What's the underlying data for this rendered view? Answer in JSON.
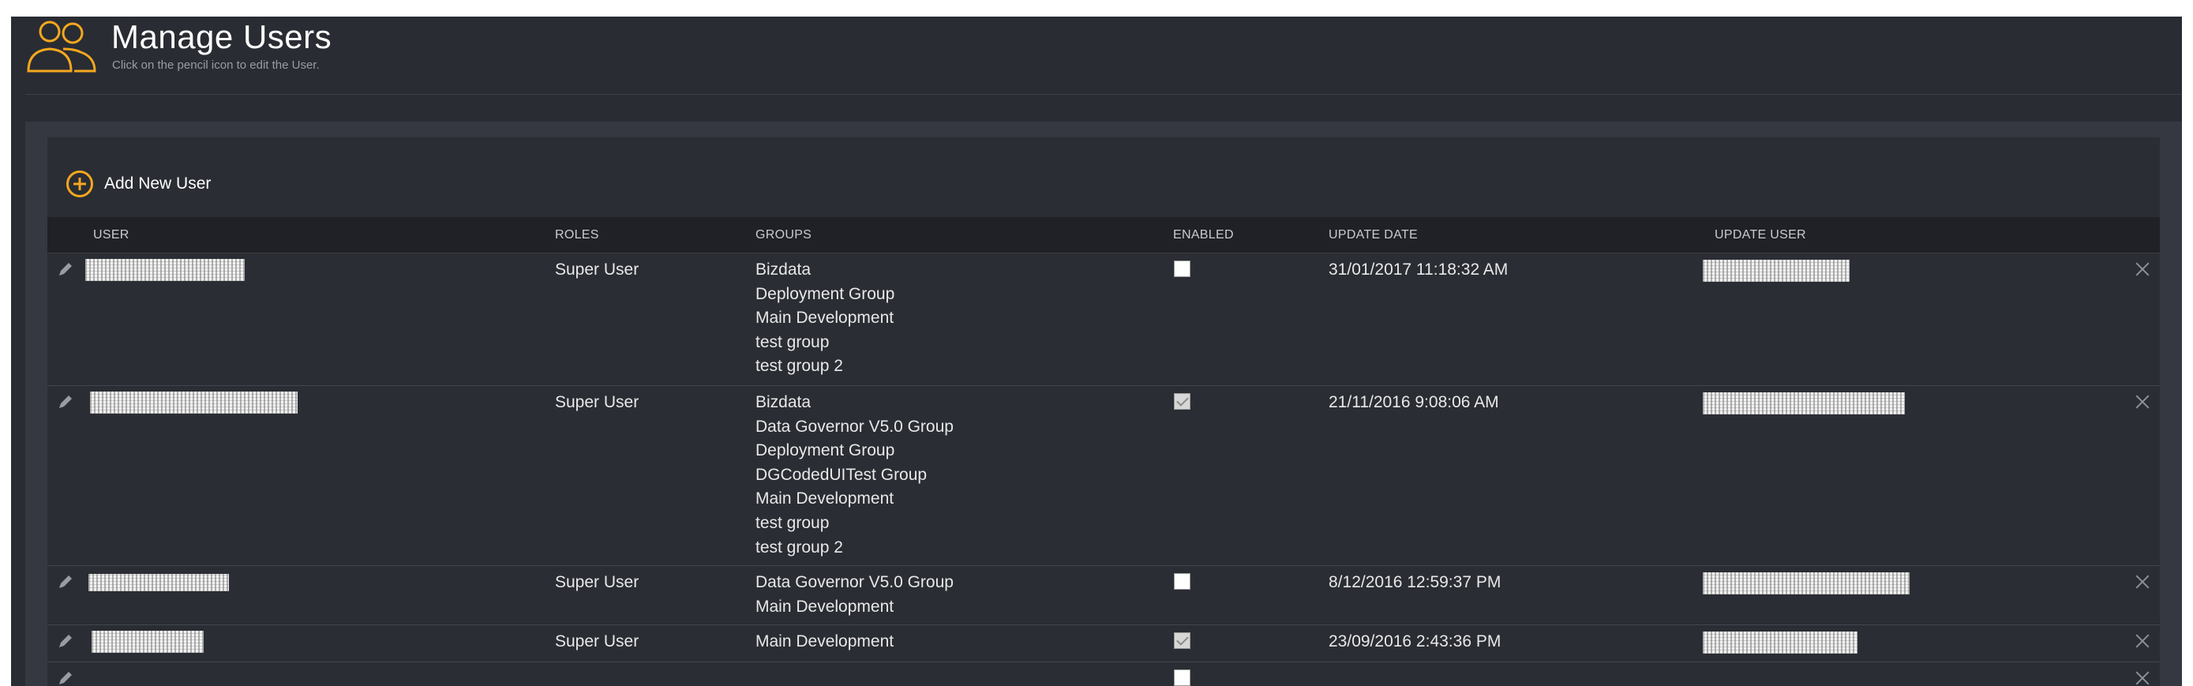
{
  "header": {
    "title": "Manage Users",
    "subtitle": "Click on the pencil icon to edit the User.",
    "icon": "users-icon",
    "accent": "#f4a81e"
  },
  "toolbar": {
    "add_label": "Add New User"
  },
  "table": {
    "columns": [
      "USER",
      "ROLES",
      "GROUPS",
      "ENABLED",
      "UPDATE DATE",
      "UPDATE USER"
    ],
    "rows": [
      {
        "role": "Super User",
        "groups": [
          "Bizdata",
          "Deployment Group",
          "Main Development",
          "test group",
          "test group 2"
        ],
        "enabled": false,
        "update_date": "31/01/2017 11:18:32 AM"
      },
      {
        "role": "Super User",
        "groups": [
          "Bizdata",
          "Data Governor V5.0 Group",
          "Deployment Group",
          "DGCodedUITest Group",
          "Main Development",
          "test group",
          "test group 2"
        ],
        "enabled": true,
        "update_date": "21/11/2016 9:08:06 AM"
      },
      {
        "role": "Super User",
        "groups": [
          "Data Governor V5.0 Group",
          "Main Development"
        ],
        "enabled": false,
        "update_date": "8/12/2016 12:59:37 PM"
      },
      {
        "role": "Super User",
        "groups": [
          "Main Development"
        ],
        "enabled": true,
        "update_date": "23/09/2016 2:43:36 PM"
      }
    ]
  }
}
